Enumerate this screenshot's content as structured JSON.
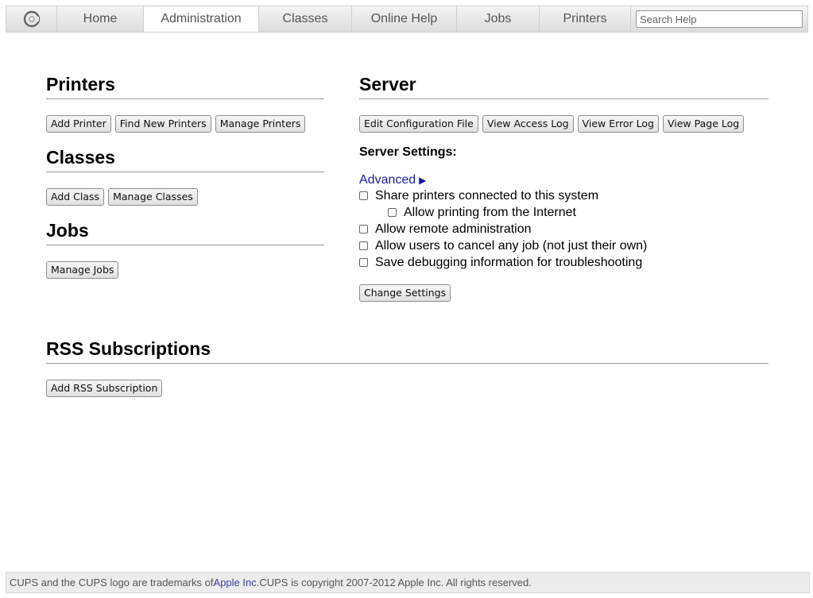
{
  "nav": {
    "logo_icon": "cups-logo-icon",
    "tabs": [
      {
        "label": "Home"
      },
      {
        "label": "Administration",
        "active": true
      },
      {
        "label": "Classes"
      },
      {
        "label": "Online Help"
      },
      {
        "label": "Jobs"
      },
      {
        "label": "Printers"
      }
    ],
    "search_placeholder": "Search Help"
  },
  "printers": {
    "heading": "Printers",
    "buttons": [
      "Add Printer",
      "Find New Printers",
      "Manage Printers"
    ]
  },
  "classes": {
    "heading": "Classes",
    "buttons": [
      "Add Class",
      "Manage Classes"
    ]
  },
  "jobs": {
    "heading": "Jobs",
    "buttons": [
      "Manage Jobs"
    ]
  },
  "server": {
    "heading": "Server",
    "buttons": [
      "Edit Configuration File",
      "View Access Log",
      "View Error Log",
      "View Page Log"
    ],
    "settings_title": "Server Settings:",
    "advanced_label": "Advanced",
    "advanced_icon": "triangle-right-icon",
    "options": [
      {
        "label": "Share printers connected to this system",
        "checked": false
      },
      {
        "label": "Allow printing from the Internet",
        "checked": false
      },
      {
        "label": "Allow remote administration",
        "checked": false
      },
      {
        "label": "Allow users to cancel any job (not just their own)",
        "checked": false
      },
      {
        "label": "Save debugging information for troubleshooting",
        "checked": false
      }
    ],
    "change_button": "Change Settings"
  },
  "rss": {
    "heading": "RSS Subscriptions",
    "button": "Add RSS Subscription"
  },
  "footer": {
    "text_before": "CUPS and the CUPS logo are trademarks of ",
    "link": "Apple Inc.",
    "text_after": " CUPS is copyright 2007-2012 Apple Inc. All rights reserved."
  },
  "colors": {
    "link": "#1a1aa6",
    "footer_link": "#3b3b9c"
  }
}
